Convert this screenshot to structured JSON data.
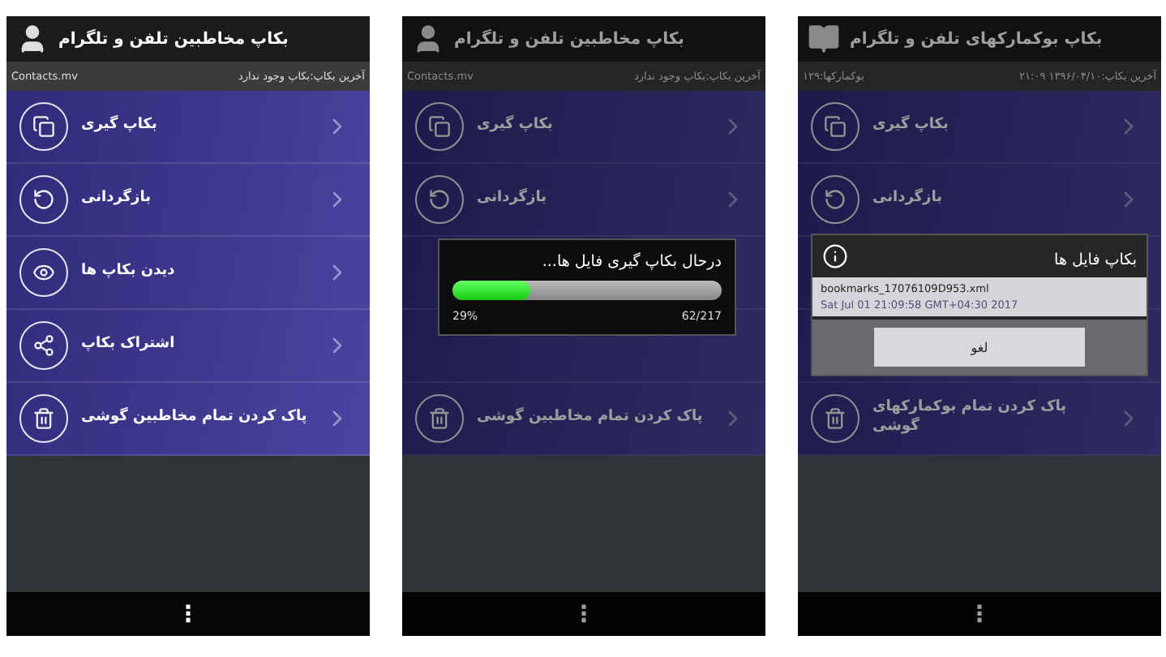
{
  "screens": [
    {
      "kind": "bookmarks",
      "title": "بکاپ بوکمارکهای تلفن و تلگرام",
      "source": "بوکمارکها:۱۲۹",
      "last_backup": "آخرین بکاپ:۱۳۹۶/۰۴/۱۰ ۲۱:۰۹",
      "dimmed": true,
      "items": [
        {
          "label": "بکاپ گیری"
        },
        {
          "label": "بازگردانی"
        },
        {
          "covered": true
        },
        {
          "covered": true
        },
        {
          "label": "پاک کردن تمام بوکمارکهای گوشی"
        }
      ],
      "dialog": {
        "kind": "files",
        "title": "بکاپ فایل ها",
        "files": [
          {
            "name": "bookmarks_17076109D953.xml",
            "date": "Sat Jul 01 21:09:58 GMT+04:30 2017"
          }
        ],
        "cancel": "لغو"
      },
      "menu": "⋮"
    },
    {
      "kind": "contacts",
      "title": "بکاپ مخاطبین تلفن و تلگرام",
      "source": "Contacts.mv",
      "last_backup": "آخرین بکاپ:بکاپ وجود ندارد",
      "dimmed": true,
      "items": [
        {
          "label": "بکاپ گیری"
        },
        {
          "label": "بازگردانی"
        },
        {
          "covered": true
        },
        {
          "covered": true
        },
        {
          "label": "پاک کردن تمام مخاطبین گوشی"
        }
      ],
      "dialog": {
        "kind": "progress",
        "title": "درحال بکاپ گیری فایل ها...",
        "level": 0.29,
        "percent": "29%",
        "count": "62/217"
      },
      "menu": "⋮"
    },
    {
      "kind": "contacts",
      "title": "بکاپ مخاطبین تلفن و تلگرام",
      "source": "Contacts.mv",
      "last_backup": "آخرین بکاپ:بکاپ وجود ندارد",
      "dimmed": false,
      "items": [
        {
          "label": "بکاپ گیری"
        },
        {
          "label": "بازگردانی"
        },
        {
          "label": "دیدن بکاپ ها"
        },
        {
          "label": "اشتراک بکاپ"
        },
        {
          "label": "پاک کردن تمام مخاطبین گوشی"
        }
      ],
      "menu": "⋮"
    }
  ]
}
